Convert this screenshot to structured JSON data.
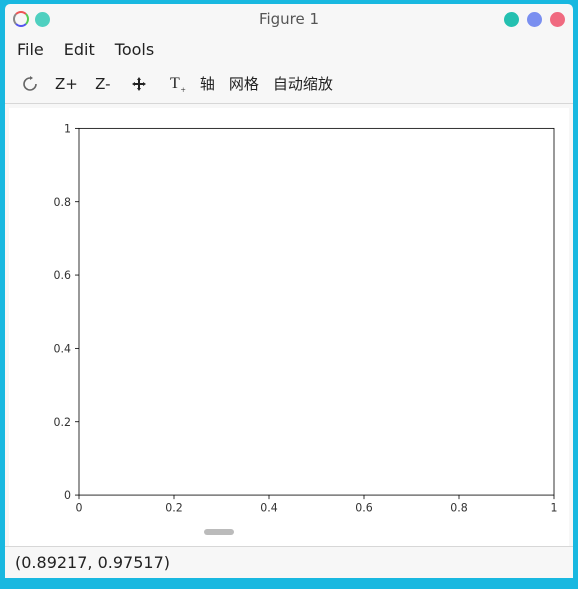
{
  "window": {
    "title": "Figure 1"
  },
  "menubar": {
    "items": [
      "File",
      "Edit",
      "Tools"
    ]
  },
  "toolbar": {
    "refresh": "↻",
    "zoom_in": "Z+",
    "zoom_out": "Z-",
    "pan": "✥",
    "text": "T₊",
    "axes": "轴",
    "grid": "网格",
    "autoscale": "自动缩放"
  },
  "chart_data": {
    "type": "line",
    "series": [],
    "x_ticks": [
      0,
      0.2,
      0.4,
      0.6,
      0.8,
      1
    ],
    "y_ticks": [
      0,
      0.2,
      0.4,
      0.6,
      0.8,
      1
    ],
    "x_tick_labels": [
      "0",
      "0.2",
      "0.4",
      "0.6",
      "0.8",
      "1"
    ],
    "y_tick_labels": [
      "0",
      "0.2",
      "0.4",
      "0.6",
      "0.8",
      "1"
    ],
    "xlim": [
      0,
      1
    ],
    "ylim": [
      0,
      1
    ],
    "title": "",
    "xlabel": "",
    "ylabel": "",
    "grid": false
  },
  "statusbar": {
    "coords": "(0.89217, 0.97517)"
  }
}
